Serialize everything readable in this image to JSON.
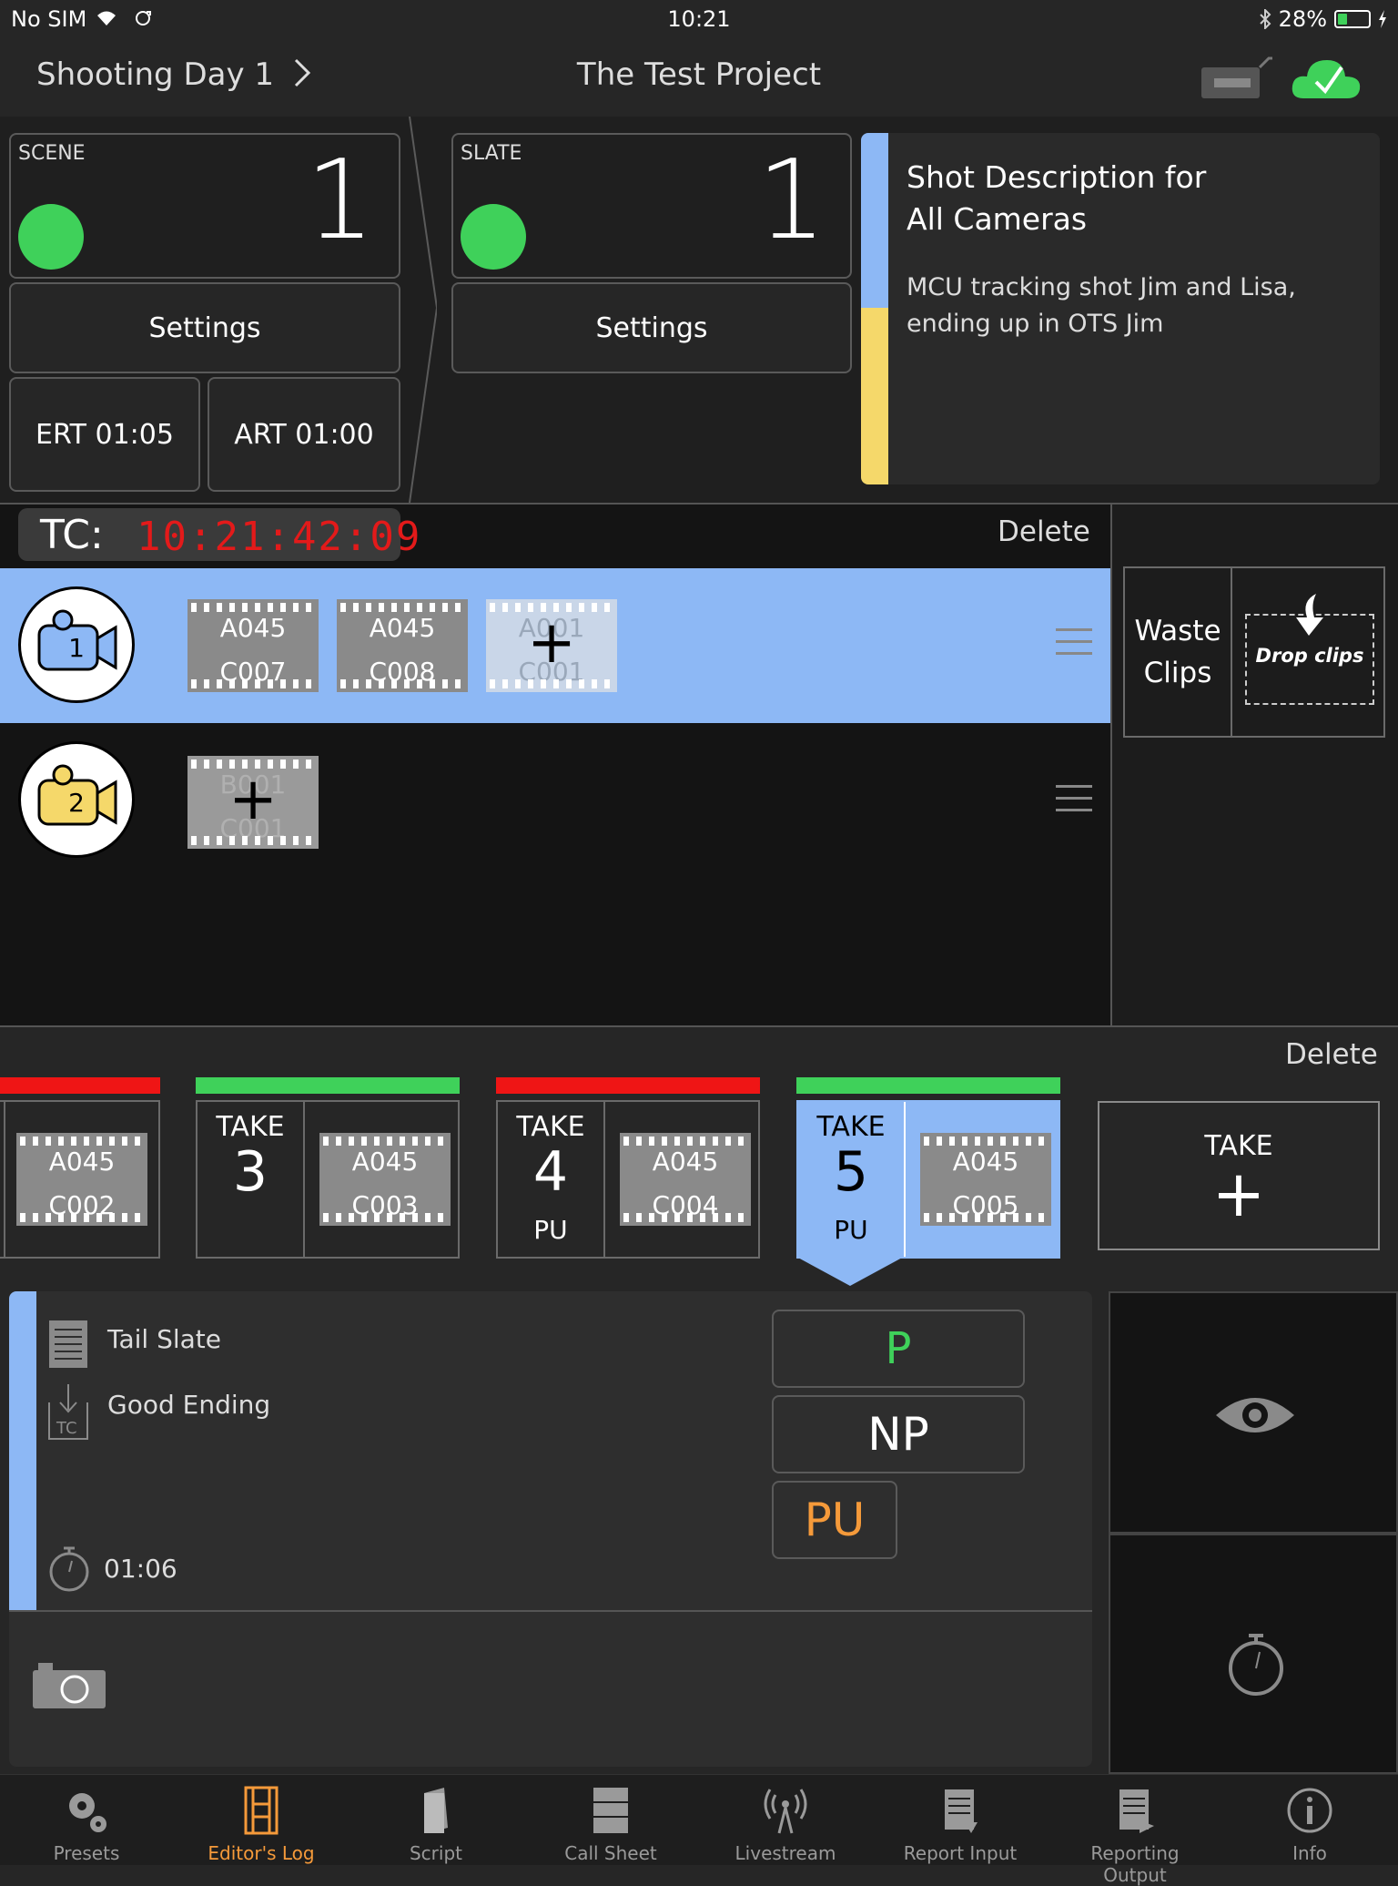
{
  "status": {
    "carrier": "No SIM",
    "time": "10:21",
    "battery": "28%"
  },
  "nav": {
    "day": "Shooting Day 1",
    "title": "The Test Project"
  },
  "scene": {
    "label": "SCENE",
    "value": "1",
    "settings": "Settings",
    "ert": "ERT 01:05",
    "art": "ART 01:00"
  },
  "slate": {
    "label": "SLATE",
    "value": "1",
    "settings": "Settings"
  },
  "shot": {
    "title_line1": "Shot Description for",
    "title_line2": "All Cameras",
    "desc_line1": "MCU tracking shot Jim and Lisa,",
    "desc_line2": "ending up in OTS Jim"
  },
  "timecode": {
    "label": "TC:",
    "value": "10:21:42:09"
  },
  "cameras": {
    "delete": "Delete",
    "cam1": {
      "number": "1",
      "clips": [
        {
          "l1": "A045",
          "l2": "C007"
        },
        {
          "l1": "A045",
          "l2": "C008"
        }
      ],
      "next": {
        "l1": "A001",
        "l2": "C001"
      }
    },
    "cam2": {
      "number": "2",
      "next": {
        "l1": "B001",
        "l2": "C001"
      }
    }
  },
  "waste": {
    "line1": "Waste",
    "line2": "Clips",
    "drop": "Drop clips"
  },
  "takes": {
    "delete": "Delete",
    "items": [
      {
        "clip1": "A045",
        "clip2": "C002",
        "status_color": "#ef1515"
      },
      {
        "label": "TAKE",
        "number": "3",
        "clip1": "A045",
        "clip2": "C003",
        "status_color": "#3fd15a"
      },
      {
        "label": "TAKE",
        "number": "4",
        "tag": "PU",
        "clip1": "A045",
        "clip2": "C004",
        "status_color": "#ef1515"
      },
      {
        "label": "TAKE",
        "number": "5",
        "tag": "PU",
        "clip1": "A045",
        "clip2": "C005",
        "status_color": "#3fd15a"
      }
    ],
    "new_label": "TAKE"
  },
  "detail": {
    "tail": "Tail Slate",
    "tc_ending": "Good Ending",
    "duration": "01:06",
    "p": "P",
    "np": "NP",
    "pu": "PU"
  },
  "tabs": [
    {
      "label": "Presets",
      "icon": "gears-icon"
    },
    {
      "label": "Editor's Log",
      "icon": "film-icon",
      "active": true
    },
    {
      "label": "Script",
      "icon": "book-icon"
    },
    {
      "label": "Call Sheet",
      "icon": "cabinet-icon"
    },
    {
      "label": "Livestream",
      "icon": "broadcast-icon"
    },
    {
      "label": "Report Input",
      "icon": "report-input-icon"
    },
    {
      "label": "Reporting Output",
      "icon": "report-output-icon"
    },
    {
      "label": "Info",
      "icon": "info-icon"
    }
  ],
  "colors": {
    "accent_blue": "#8db8f5",
    "yellow": "#f5d86a",
    "green": "#3fd15a",
    "red": "#ef1515",
    "orange": "#f59a3a"
  }
}
